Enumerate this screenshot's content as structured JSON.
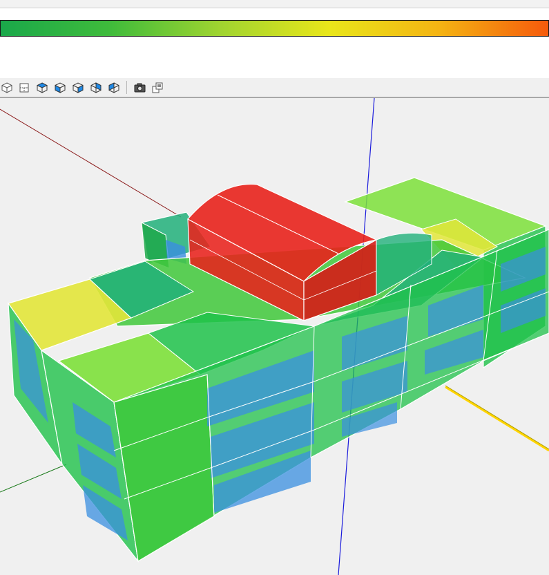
{
  "legend": {
    "gradient_colors": [
      "#1aa84a",
      "#3fbb3b",
      "#9fd430",
      "#e9e61a",
      "#f4b413",
      "#f55a0c"
    ]
  },
  "toolbar": {
    "buttons": [
      {
        "name": "view-isometric-icon"
      },
      {
        "name": "view-plan-icon"
      },
      {
        "name": "view-top-icon"
      },
      {
        "name": "view-front-icon"
      },
      {
        "name": "view-right-icon"
      },
      {
        "name": "view-back-icon"
      },
      {
        "name": "view-left-icon"
      },
      {
        "name": "camera-icon"
      },
      {
        "name": "screenshot-icon"
      }
    ]
  },
  "viewport": {
    "background": "#f0f0f0",
    "axis_colors": {
      "x": "#8b1a1a",
      "y": "#1a7a1a",
      "z": "#1a1adc",
      "highlight": "#ffd400"
    },
    "surface_colors": {
      "red": "#e8221c",
      "green": "#1fc24a",
      "light_green": "#7de03a",
      "yellow": "#e2e63a",
      "teal": "#21b07a",
      "window_blue": "#3a8fe0"
    }
  }
}
